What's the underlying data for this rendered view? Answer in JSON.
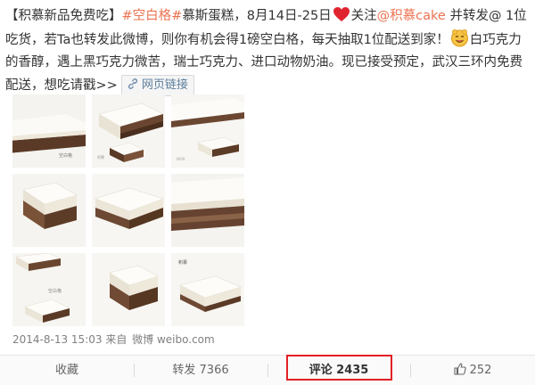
{
  "post": {
    "text_1": "【积慕新品免费吃】",
    "tag_1": "#空白格#",
    "text_2": "慕斯蛋糕，8月14日-25日",
    "text_3": "关注",
    "mention_1": "@积慕cake",
    "text_4": " 并转发@ 1位吃货，若Ta也转发此微博，则你有机会得1磅空白格，每天抽取1位配送到家！",
    "text_5": "白巧克力的香醇，遇上黑巧克力微苦，瑞士巧克力、进口动物奶油。现已接受预定，武汉三环内免费配送，想吃请戳>>",
    "web_link_label": "网页链接",
    "emoji_heart": "heart-icon",
    "emoji_face": "yummy-face-icon"
  },
  "meta": {
    "time": "2014-8-13 15:03",
    "source_prefix": "来自",
    "source": "微博 weibo.com"
  },
  "actions": {
    "favorite": "收藏",
    "repost": "转发 7366",
    "comment": "评论 2435",
    "like_count": "252"
  },
  "colors": {
    "link": "#eb7350",
    "highlight_border": "#e21f26",
    "meta_text": "#808080"
  }
}
